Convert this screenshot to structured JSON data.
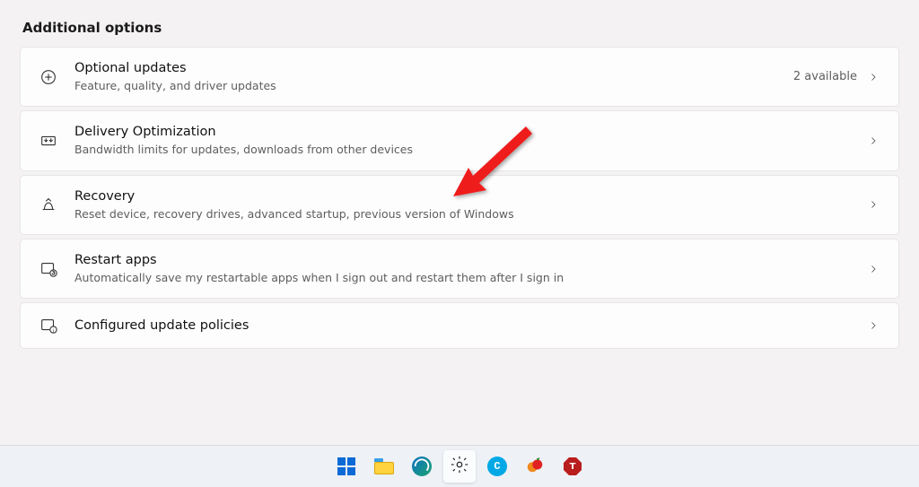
{
  "section_title": "Additional options",
  "cards": [
    {
      "id": "optional-updates",
      "icon": "plus-circle-icon",
      "title": "Optional updates",
      "sub": "Feature, quality, and driver updates",
      "meta": "2 available"
    },
    {
      "id": "delivery-optimization",
      "icon": "download-box-icon",
      "title": "Delivery Optimization",
      "sub": "Bandwidth limits for updates, downloads from other devices",
      "meta": ""
    },
    {
      "id": "recovery",
      "icon": "recovery-icon",
      "title": "Recovery",
      "sub": "Reset device, recovery drives, advanced startup, previous version of Windows",
      "meta": ""
    },
    {
      "id": "restart-apps",
      "icon": "restart-apps-icon",
      "title": "Restart apps",
      "sub": "Automatically save my restartable apps when I sign out and restart them after I sign in",
      "meta": ""
    },
    {
      "id": "configured-policies",
      "icon": "policy-icon",
      "title": "Configured update policies",
      "sub": "",
      "meta": ""
    }
  ],
  "taskbar": {
    "icons": [
      {
        "id": "start",
        "name": "windows-start-icon"
      },
      {
        "id": "explorer",
        "name": "file-explorer-icon"
      },
      {
        "id": "edge",
        "name": "edge-browser-icon"
      },
      {
        "id": "settings",
        "name": "settings-gear-icon",
        "active": true
      },
      {
        "id": "c-app",
        "name": "blue-c-app-icon",
        "letter": "C"
      },
      {
        "id": "yuzu",
        "name": "fruit-app-icon"
      },
      {
        "id": "adblock",
        "name": "red-octagon-app-icon",
        "letter": "T"
      }
    ]
  },
  "annotation": {
    "points_to": "recovery"
  }
}
